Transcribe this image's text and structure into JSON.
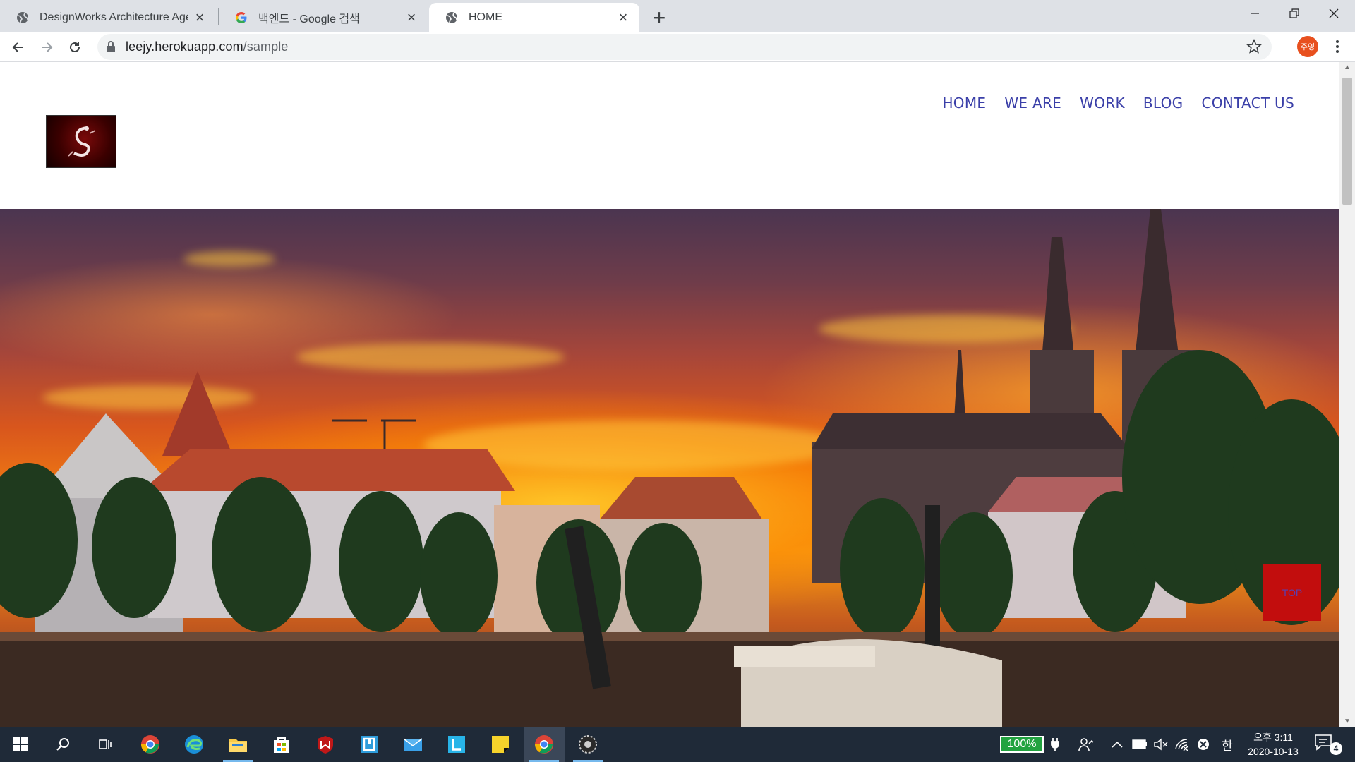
{
  "browser": {
    "tabs": [
      {
        "title": "DesignWorks Architecture Agen",
        "favicon": "globe-icon",
        "active": false
      },
      {
        "title": "백엔드 - Google 검색",
        "favicon": "google-g-icon",
        "active": false
      },
      {
        "title": "HOME",
        "favicon": "globe-icon",
        "active": true
      }
    ],
    "url_host": "leejy.herokuapp.com",
    "url_path": "/sample",
    "profile_initials": "주영"
  },
  "site": {
    "nav": [
      "HOME",
      "WE ARE",
      "WORK",
      "BLOG",
      "CONTACT US"
    ],
    "top_button_label": "TOP",
    "logo_glyph": "S"
  },
  "taskbar": {
    "battery_label": "100%",
    "ime_label": "한",
    "clock_time": "오후 3:11",
    "clock_date": "2020-10-13",
    "notifications_count": "4"
  },
  "colors": {
    "nav_link": "#3a3fa8",
    "top_button": "#c20d0d",
    "taskbar_bg": "#1f2a38",
    "battery_green": "#22a340"
  }
}
